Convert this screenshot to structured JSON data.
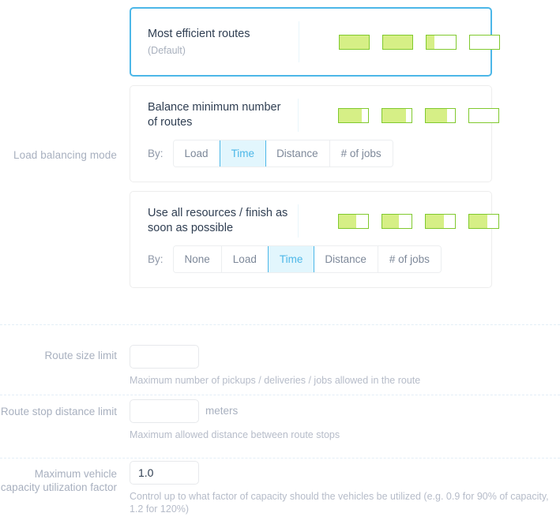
{
  "load_balancing": {
    "label": "Load balancing mode",
    "by_label": "By:",
    "modes": [
      {
        "title": "Most efficient routes",
        "subtitle": "(Default)",
        "selected": true,
        "bars": [
          100,
          100,
          26,
          0
        ],
        "options": []
      },
      {
        "title": "Balance minimum number of routes",
        "subtitle": "",
        "selected": false,
        "bars": [
          78,
          80,
          72,
          0
        ],
        "options": [
          "Load",
          "Time",
          "Distance",
          "# of jobs"
        ],
        "selected_option": "Time"
      },
      {
        "title": "Use all resources / finish as soon as possible",
        "subtitle": "",
        "selected": false,
        "bars": [
          60,
          58,
          62,
          62
        ],
        "options": [
          "None",
          "Load",
          "Time",
          "Distance",
          "# of jobs"
        ],
        "selected_option": "Time"
      }
    ]
  },
  "fields": [
    {
      "label": "Route size limit",
      "value": "",
      "unit": "",
      "helper": "Maximum number of pickups / deliveries / jobs allowed in the route"
    },
    {
      "label": "Route stop distance limit",
      "value": "",
      "unit": "meters",
      "helper": "Maximum allowed distance between route stops"
    },
    {
      "label": "Maximum vehicle capacity utilization factor",
      "value": "1.0",
      "unit": "",
      "helper": "Control up to what factor of capacity should the vehicles be utilized (e.g. 0.9 for 90% of capacity, 1.2 for 120%)"
    }
  ],
  "colors": {
    "accent_blue": "#4cb7e8",
    "accent_blue_bg": "#e2f6fd",
    "bar_border_green": "#80c92e",
    "bar_fill_green": "#d6ef86",
    "label_gray": "#a8b0bf",
    "title_navy": "#2f3e52"
  }
}
